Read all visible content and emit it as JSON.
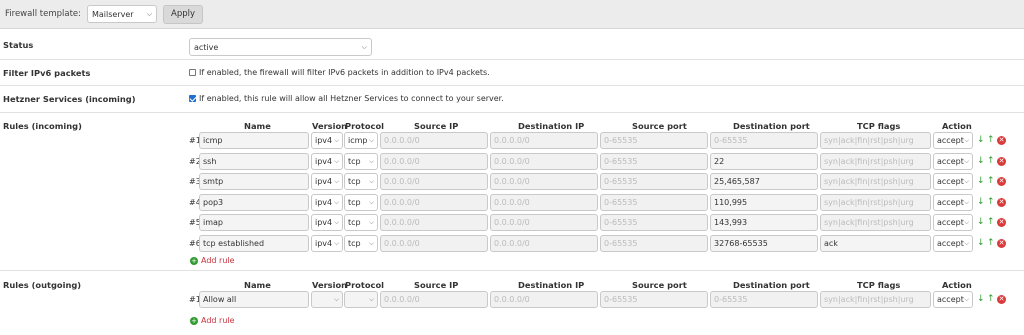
{
  "topbar": {
    "template_label": "Firewall template:",
    "template_value": "Mailserver",
    "apply_label": "Apply"
  },
  "status": {
    "label": "Status",
    "value": "active"
  },
  "ipv6": {
    "label": "Filter IPv6 packets",
    "text": "If enabled, the firewall will filter IPv6 packets in addition to IPv4 packets.",
    "checked": false
  },
  "hetzner": {
    "label": "Hetzner Services (incoming)",
    "text": "If enabled, this rule will allow all Hetzner Services to connect to your server.",
    "checked": true
  },
  "headers": {
    "name": "Name",
    "version": "Version",
    "protocol": "Protocol",
    "source_ip": "Source IP",
    "destination_ip": "Destination IP",
    "source_port": "Source port",
    "destination_port": "Destination port",
    "tcp_flags": "TCP flags",
    "action": "Action"
  },
  "incoming": {
    "label": "Rules (incoming)",
    "add_label": "Add rule",
    "rules": [
      {
        "num": "#1",
        "name": "icmp",
        "version": "ipv4",
        "protocol": "icmp",
        "source_ip": "0.0.0.0/0",
        "destination_ip": "0.0.0.0/0",
        "source_port": "0-65535",
        "destination_port": "0-65535",
        "tcp_flags": "syn|ack|fin|rst|psh|urg",
        "action": "accept"
      },
      {
        "num": "#2",
        "name": "ssh",
        "version": "ipv4",
        "protocol": "tcp",
        "source_ip": "0.0.0.0/0",
        "destination_ip": "0.0.0.0/0",
        "source_port": "0-65535",
        "destination_port": "22",
        "tcp_flags": "syn|ack|fin|rst|psh|urg",
        "action": "accept"
      },
      {
        "num": "#3",
        "name": "smtp",
        "version": "ipv4",
        "protocol": "tcp",
        "source_ip": "0.0.0.0/0",
        "destination_ip": "0.0.0.0/0",
        "source_port": "0-65535",
        "destination_port": "25,465,587",
        "tcp_flags": "syn|ack|fin|rst|psh|urg",
        "action": "accept"
      },
      {
        "num": "#4",
        "name": "pop3",
        "version": "ipv4",
        "protocol": "tcp",
        "source_ip": "0.0.0.0/0",
        "destination_ip": "0.0.0.0/0",
        "source_port": "0-65535",
        "destination_port": "110,995",
        "tcp_flags": "syn|ack|fin|rst|psh|urg",
        "action": "accept"
      },
      {
        "num": "#5",
        "name": "imap",
        "version": "ipv4",
        "protocol": "tcp",
        "source_ip": "0.0.0.0/0",
        "destination_ip": "0.0.0.0/0",
        "source_port": "0-65535",
        "destination_port": "143,993",
        "tcp_flags": "syn|ack|fin|rst|psh|urg",
        "action": "accept"
      },
      {
        "num": "#6",
        "name": "tcp established",
        "version": "ipv4",
        "protocol": "tcp",
        "source_ip": "0.0.0.0/0",
        "destination_ip": "0.0.0.0/0",
        "source_port": "0-65535",
        "destination_port": "32768-65535",
        "tcp_flags": "ack",
        "action": "accept"
      }
    ]
  },
  "outgoing": {
    "label": "Rules (outgoing)",
    "add_label": "Add rule",
    "rules": [
      {
        "num": "#1",
        "name": "Allow all",
        "version": "",
        "protocol": "",
        "source_ip": "0.0.0.0/0",
        "destination_ip": "0.0.0.0/0",
        "source_port": "0-65535",
        "destination_port": "0-65535",
        "tcp_flags": "syn|ack|fin|rst|psh|urg",
        "action": "accept"
      }
    ]
  },
  "colors": {
    "topbar_bg": "#ececec",
    "accept_icon": "#2e9b2e",
    "delete_icon": "#d93a3a",
    "add_rule_text": "#c8343d"
  }
}
